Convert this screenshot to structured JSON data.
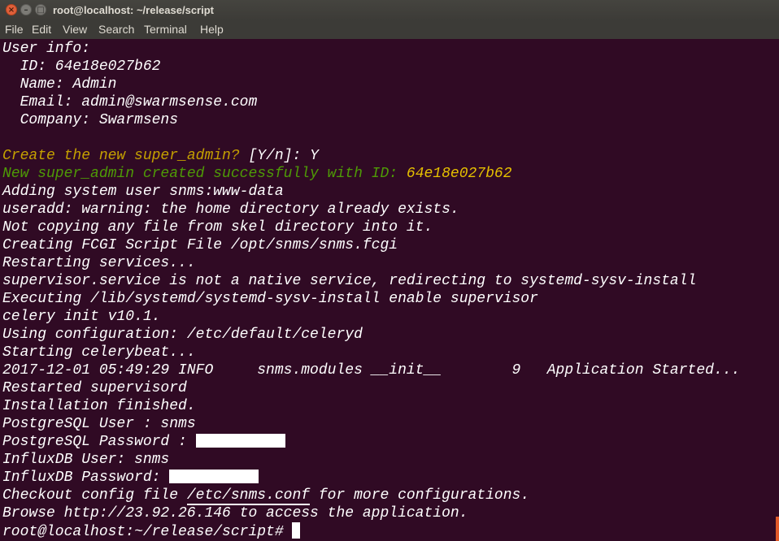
{
  "window": {
    "title": "root@localhost: ~/release/script",
    "buttons": {
      "close_glyph": "×",
      "minimize_glyph": "–",
      "maximize_glyph": "□"
    }
  },
  "menu": [
    "File",
    "Edit",
    "View",
    "Search",
    "Terminal",
    "Help"
  ],
  "terminal": {
    "lines": [
      "User info:",
      "  ID: 64e18e027b62",
      "  Name: Admin",
      "  Email: admin@swarmsense.com",
      "  Company: Swarmsens",
      "",
      {
        "prompt": "Create the new super_admin? ",
        "answer": "[Y/n]: Y"
      },
      {
        "message": "New super_admin created successfully with ID: ",
        "id": "64e18e027b62"
      },
      "Adding system user snms:www-data",
      "useradd: warning: the home directory already exists.",
      "Not copying any file from skel directory into it.",
      "Creating FCGI Script File /opt/snms/snms.fcgi",
      "Restarting services...",
      "supervisor.service is not a native service, redirecting to systemd-sysv-install",
      "Executing /lib/systemd/systemd-sysv-install enable supervisor",
      "celery init v10.1.",
      "Using configuration: /etc/default/celeryd",
      "Starting celerybeat...",
      "2017-12-01 05:49:29 INFO     snms.modules __init__        9   Application Started...",
      "Restarted supervisord",
      "Installation finished.",
      "PostgreSQL User : snms",
      {
        "label": "PostgreSQL Password : "
      },
      "InfluxDB User: snms",
      {
        "label": "InfluxDB Password: "
      },
      {
        "before": "Checkout config file ",
        "path": "/etc/snms.conf",
        "after": " for more configurations."
      },
      "Browse http://23.92.26.146 to access the application.",
      {
        "prompt": "root@localhost:~/release/script# "
      }
    ]
  },
  "colors": {
    "background": "#300a24",
    "titlebar": "#3c3b37",
    "prompt_yellow": "#c4a000",
    "success_green": "#4e9a06",
    "close_button": "#e0603a"
  }
}
